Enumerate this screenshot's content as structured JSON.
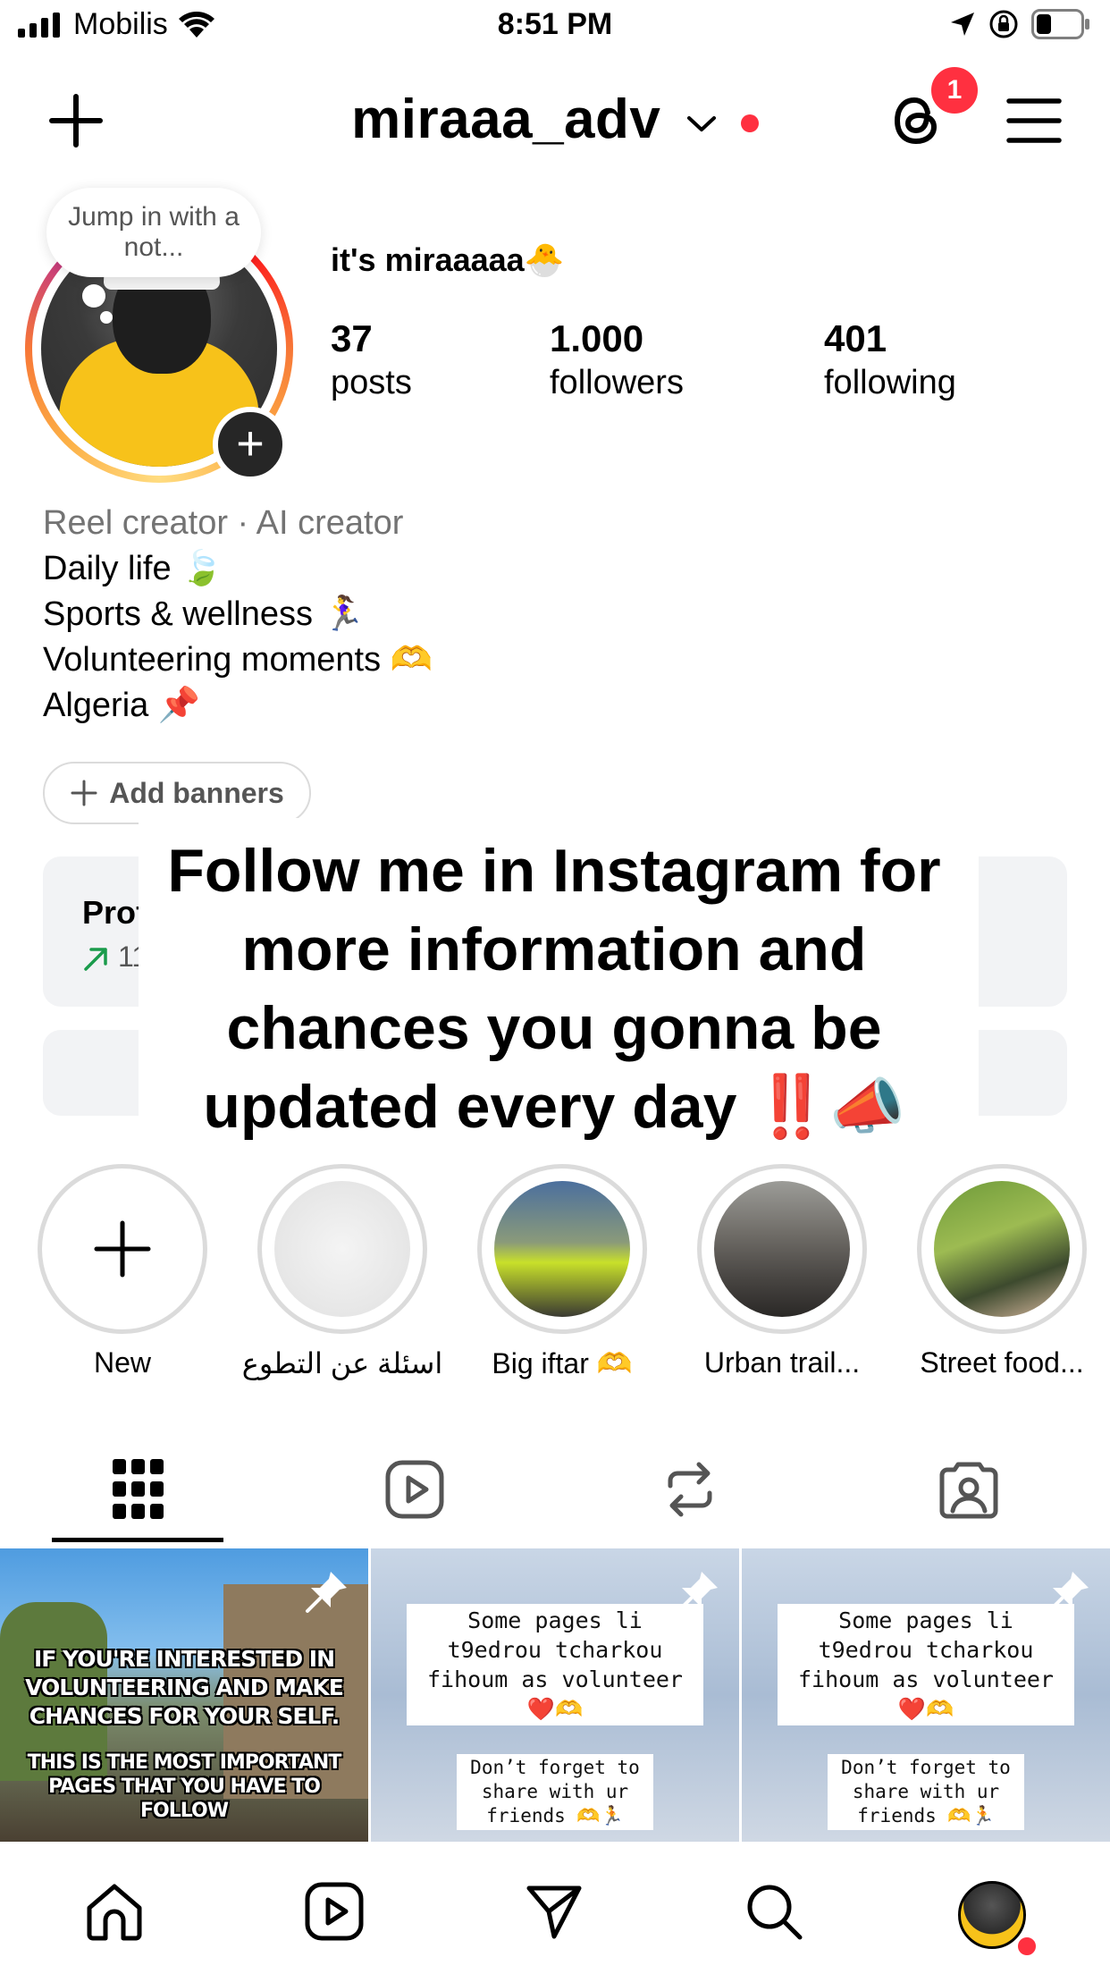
{
  "status_bar": {
    "carrier": "Mobilis",
    "time": "8:51 PM"
  },
  "header": {
    "username": "miraaa_adv",
    "threads_badge": "1"
  },
  "profile": {
    "note": "Jump in with a not...",
    "display_name": "it's miraaaaa🐣",
    "stats": [
      {
        "num": "37",
        "label": "posts"
      },
      {
        "num": "1.000",
        "label": "followers"
      },
      {
        "num": "401",
        "label": "following"
      }
    ],
    "bio_category": "Reel creator · AI creator",
    "bio_lines": [
      "Daily life 🍃",
      "Sports & wellness 🏃‍♀️",
      "Volunteering moments 🫶",
      "Algeria 📌"
    ],
    "add_banners": "Add banners"
  },
  "dashboard": {
    "title_partial": "Profe",
    "value_partial": "119."
  },
  "overlay_caption": "Follow me in Instagram for more information and chances you gonna be updated every day ‼️📣",
  "highlights": [
    {
      "label": "New"
    },
    {
      "label": "اسئلة عن التطوع"
    },
    {
      "label": "Big iftar 🫶"
    },
    {
      "label": "Urban trail..."
    },
    {
      "label": "Street food..."
    }
  ],
  "tabs": [
    "grid-icon",
    "reels-icon",
    "reposts-icon",
    "tagged-icon"
  ],
  "grid": {
    "post1": {
      "line1": "IF YOU'RE INTERESTED IN",
      "line2": "VOLUNTEERING AND MAKE",
      "line3": "CHANCES FOR YOUR SELF.",
      "line4": "THIS IS THE MOST IMPORTANT",
      "line5": "PAGES THAT YOU HAVE TO FOLLOW"
    },
    "post2": {
      "box1_l1": "Some pages li",
      "box1_l2": "t9edrou tcharkou",
      "box1_l3": "fihoum as volunteer",
      "box1_l4": "❤️🫶",
      "box2_l1": "Don’t forget to",
      "box2_l2": "share with ur",
      "box2_l3": "friends 🫶🏃"
    },
    "post3": {
      "box1_l1": "Some pages li",
      "box1_l2": "t9edrou tcharkou",
      "box1_l3": "fihoum as volunteer",
      "box1_l4": "❤️🫶",
      "box2_l1": "Don’t forget to",
      "box2_l2": "share with ur",
      "box2_l3": "friends 🫶🏃"
    }
  },
  "colors": {
    "accent_red": "#ff3040",
    "muted": "#737373"
  }
}
